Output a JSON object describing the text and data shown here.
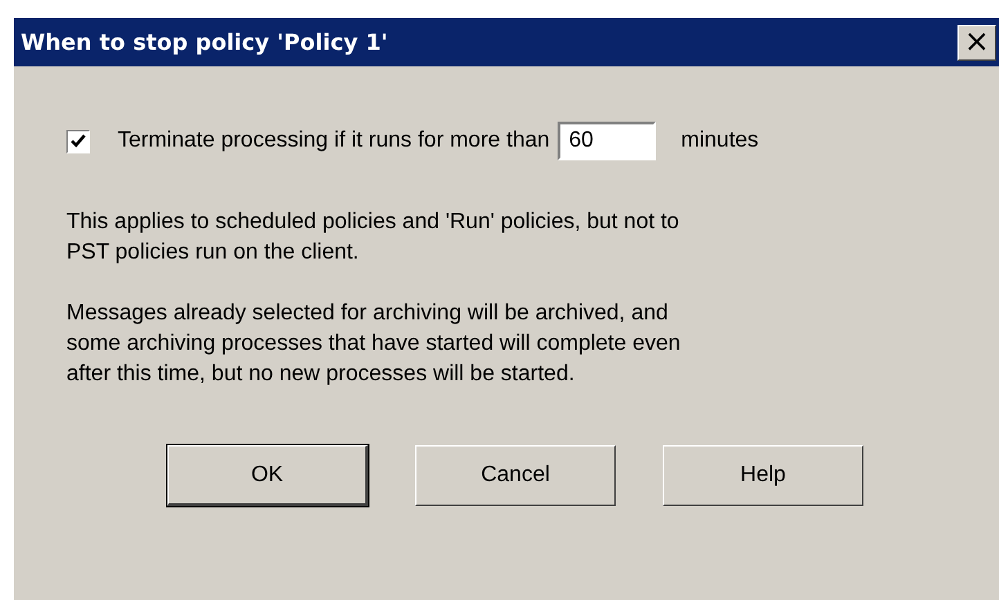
{
  "window": {
    "title": "When to stop policy 'Policy 1'",
    "close": "×"
  },
  "option": {
    "checked": true,
    "label": "Terminate processing if it runs for more than",
    "value": "60",
    "unit": "minutes"
  },
  "paragraphs": [
    "This applies to scheduled policies and 'Run' policies, but not to\nPST policies run on the client.",
    "Messages already selected for archiving will be archived, and\nsome archiving processes that have started will complete even\nafter this time, but no new processes will be started."
  ],
  "buttons": [
    {
      "label": "OK",
      "default": true
    },
    {
      "label": "Cancel",
      "default": false
    },
    {
      "label": "Help",
      "default": false
    }
  ]
}
